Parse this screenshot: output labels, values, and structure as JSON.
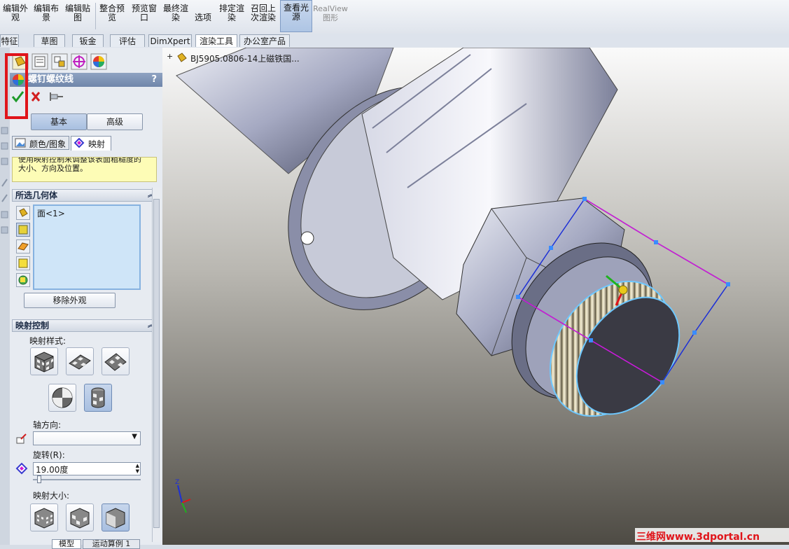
{
  "ribbon": {
    "buttons": [
      {
        "label": "编辑外\n观"
      },
      {
        "label": "编辑布\n景"
      },
      {
        "label": "编辑贴\n图"
      },
      {
        "label": "整合预\n览"
      },
      {
        "label": "预览窗\n口"
      },
      {
        "label": "最终渲\n染"
      },
      {
        "label": "选项"
      },
      {
        "label": "排定渲\n染"
      },
      {
        "label": "召回上\n次渲染"
      },
      {
        "label": "查看光\n源"
      },
      {
        "label": "RealView\n图形"
      }
    ]
  },
  "tabs": [
    "特征",
    "草图",
    "钣金",
    "评估",
    "DimXpert",
    "渲染工具",
    "办公室产品"
  ],
  "active_tab": "渲染工具",
  "tree": {
    "root_label": "BJ5905.0806-14上磁铁国..."
  },
  "property_manager": {
    "title": "螺钉螺纹线",
    "help": "?",
    "mode_tabs": [
      "基本",
      "高级"
    ],
    "sub_tabs": [
      "颜色/图象",
      "映射"
    ],
    "hint_text": "使用映射控制来调整该表面粗糙度的大小、方向及位置。",
    "selected_geometry": {
      "header": "所选几何体",
      "items": [
        "面<1>"
      ],
      "remove_button": "移除外观"
    },
    "mapping_control": {
      "header": "映射控制",
      "style_label": "映射样式:",
      "axis_label": "轴方向:",
      "axis_value": "",
      "rotation_label": "旋转(R):",
      "rotation_value": "19.00度",
      "size_label": "映射大小:",
      "selected_style": "cylindrical",
      "selected_size": "fit"
    }
  },
  "bottom_tabs": [
    "模型",
    "运动算例 1"
  ],
  "watermark": "三维网www.3dportal.cn",
  "colors": {
    "highlight_red": "#e0141a",
    "sketch_blue": "#1c2fd6",
    "sketch_magenta": "#d21ad2",
    "selection_cyan": "#6ec8ff"
  }
}
